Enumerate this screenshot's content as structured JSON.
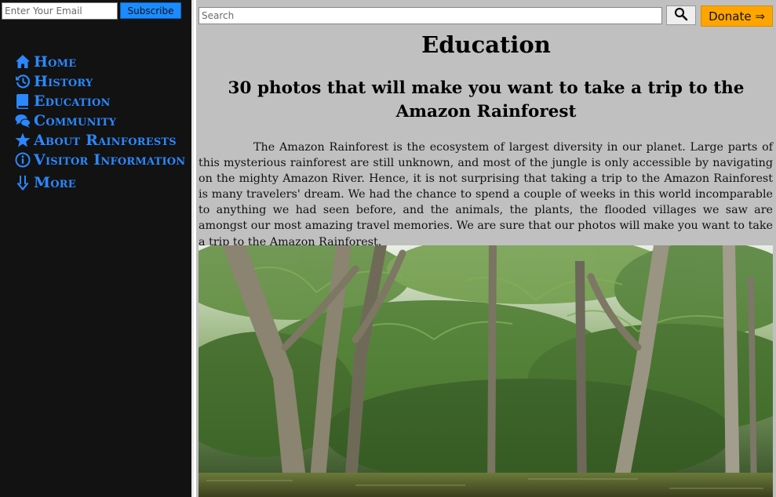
{
  "sidebar": {
    "email_placeholder": "Enter Your Email",
    "subscribe_label": "Subscribe",
    "nav": [
      {
        "label": "Home",
        "icon": "home-icon"
      },
      {
        "label": "History",
        "icon": "history-icon"
      },
      {
        "label": "Education",
        "icon": "book-icon"
      },
      {
        "label": "Community",
        "icon": "comments-icon"
      },
      {
        "label": "About Rainforests",
        "icon": "star-icon"
      },
      {
        "label": "Visitor Information",
        "icon": "info-icon"
      },
      {
        "label": "More",
        "icon": "arrow-down-icon"
      }
    ]
  },
  "header": {
    "search_placeholder": "Search",
    "search_icon": "search-icon",
    "donate_label": "Donate ⇒"
  },
  "main": {
    "page_title": "Education",
    "article_title": "30 photos that will make you want to take a trip to the Amazon Rainforest",
    "article_body": "The Amazon Rainforest is the ecosystem of largest diversity in our planet. Large parts of this mysterious rainforest are still unknown, and most of the jungle is only accessible by navigating on the mighty Amazon River. Hence, it is not surprising that taking a trip to the Amazon Rainforest is many travelers' dream. We had the chance to spend a couple of weeks in this world incomparable to anything we had seen before, and the animals, the plants, the flooded villages we saw are amongst our most amazing travel memories. We are sure that our photos will make you want to take a trip to the Amazon Rainforest."
  },
  "colors": {
    "sidebar_bg": "#121212",
    "nav_link": "#2b88ff",
    "main_bg": "#c0c0c0",
    "subscribe_bg": "#1a8cff",
    "donate_bg": "#ffa500"
  }
}
